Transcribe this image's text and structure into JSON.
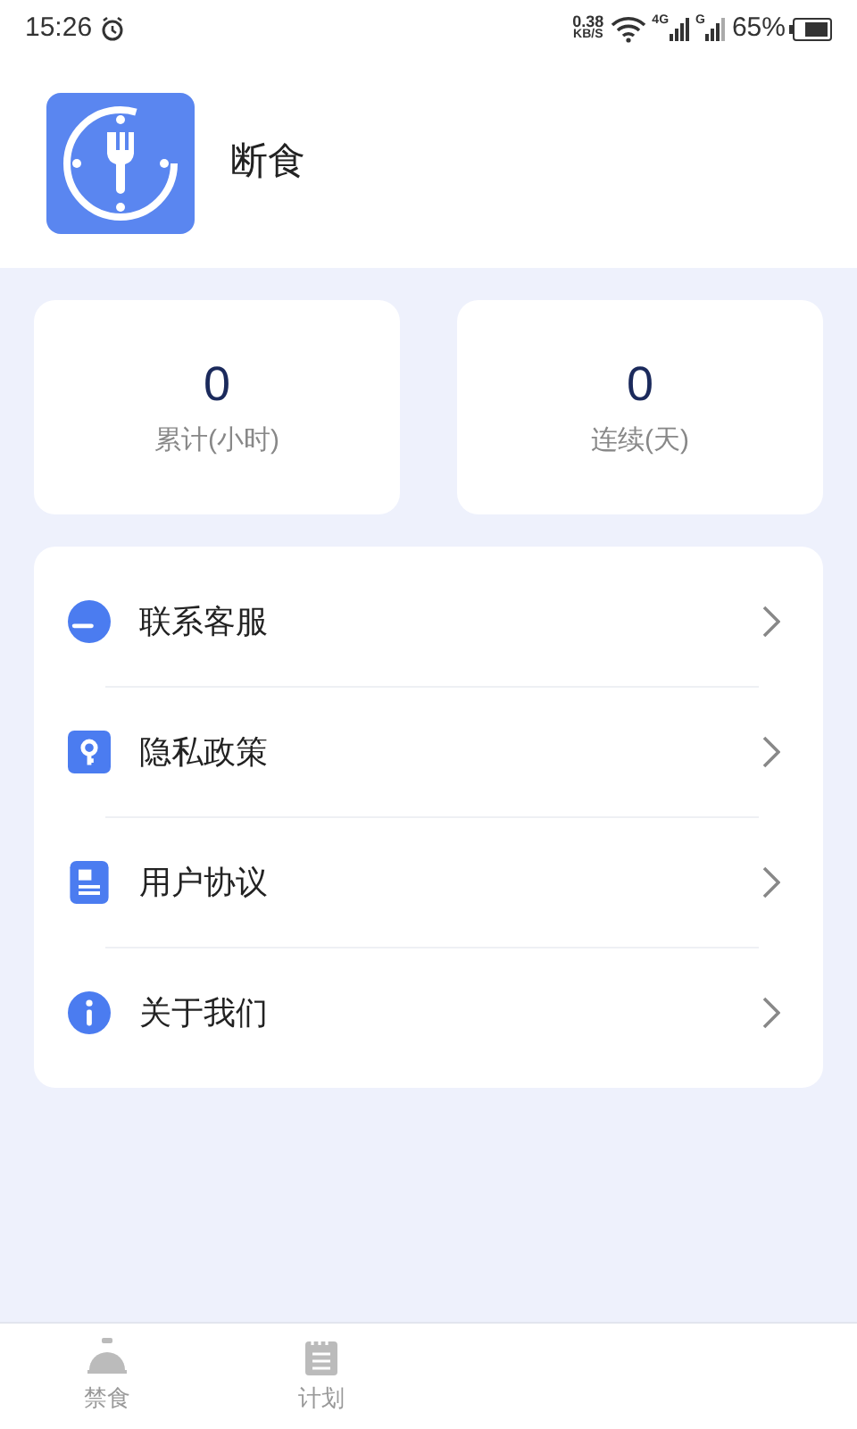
{
  "status_bar": {
    "time": "15:26",
    "speed_value": "0.38",
    "speed_unit": "KB/S",
    "network_1": "4G",
    "network_2": "G",
    "battery": "65%"
  },
  "header": {
    "app_name": "断食"
  },
  "stats": [
    {
      "value": "0",
      "label": "累计(小时)"
    },
    {
      "value": "0",
      "label": "连续(天)"
    }
  ],
  "menu": [
    {
      "kind": "service",
      "label": "联系客服"
    },
    {
      "kind": "privacy",
      "label": "隐私政策"
    },
    {
      "kind": "agreement",
      "label": "用户协议"
    },
    {
      "kind": "about",
      "label": "关于我们"
    }
  ],
  "tabs": [
    {
      "kind": "fasting",
      "label": "禁食",
      "selected": false
    },
    {
      "kind": "plan",
      "label": "计划",
      "selected": false
    }
  ]
}
